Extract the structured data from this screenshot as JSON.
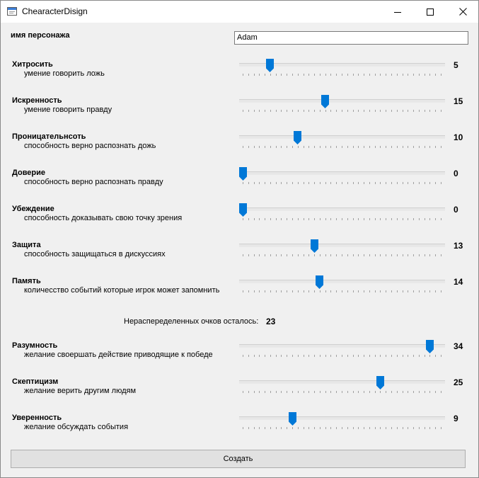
{
  "window": {
    "title": "ChearacterDisign",
    "icon": "app-window-icon",
    "buttons": {
      "minimize": "minimize-icon",
      "maximize": "maximize-icon",
      "close": "close-icon"
    }
  },
  "name_field": {
    "label": "имя персонажа",
    "value": "Adam"
  },
  "slider_range": {
    "min": 0,
    "max": 36
  },
  "accent_color": "#0078d7",
  "sliders_group1": [
    {
      "id": "hitrost",
      "label": "Хитросить",
      "description": "умение говорить ложь",
      "value": "5"
    },
    {
      "id": "iskrennost",
      "label": "Искренность",
      "description": "умение говорить правду",
      "value": "15"
    },
    {
      "id": "pronicatelnost",
      "label": "Проницательнсоть",
      "description": "способность верно распознать дожь",
      "value": "10"
    },
    {
      "id": "doverie",
      "label": "Доверие",
      "description": "способность верно распознать правду",
      "value": "0"
    },
    {
      "id": "ubezhdenie",
      "label": "Убеждение",
      "description": "способность доказывать свою точку зрения",
      "value": "0"
    },
    {
      "id": "zaschita",
      "label": "Защита",
      "description": "способность защищаться в дискуссиях",
      "value": "13"
    },
    {
      "id": "pamyat",
      "label": "Память",
      "description": "количесство событий которые игрок может запомнить",
      "value": "14"
    }
  ],
  "remaining": {
    "label": "Нераспеределенных очков осталось:",
    "value": "23"
  },
  "sliders_group2": [
    {
      "id": "razumnost",
      "label": "Разумность",
      "description": "желание своершать действие приводящие к победе",
      "value": "34"
    },
    {
      "id": "skepticizm",
      "label": "Скептицизм",
      "description": "желание верить другим людям",
      "value": "25"
    },
    {
      "id": "uverennost",
      "label": "Уверенность",
      "description": "желание обсуждать события",
      "value": "9"
    }
  ],
  "create_button": {
    "label": "Создать"
  }
}
